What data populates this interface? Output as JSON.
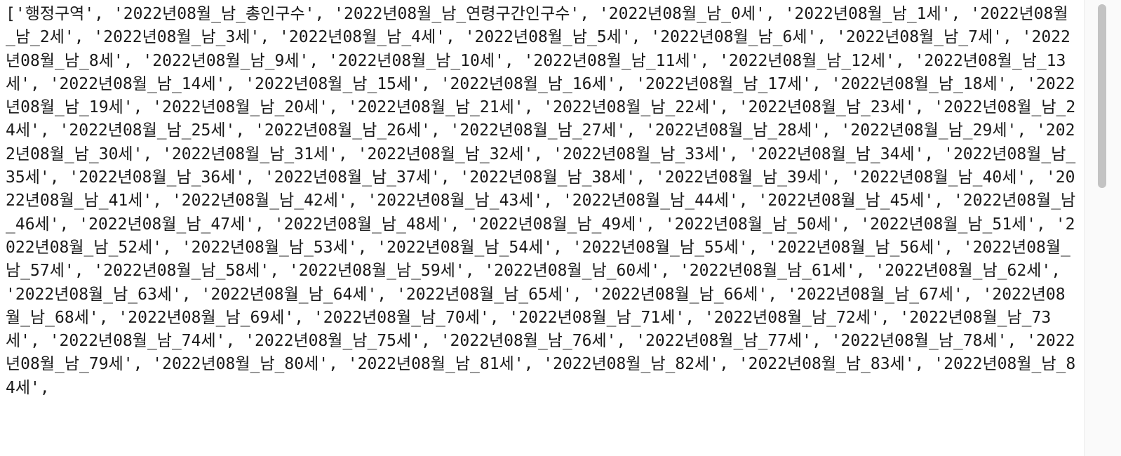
{
  "output": {
    "label": "output",
    "columns": [
      "행정구역",
      "2022년08월_남_총인구수",
      "2022년08월_남_연령구간인구수",
      "2022년08월_남_0세",
      "2022년08월_남_1세",
      "2022년08월_남_2세",
      "2022년08월_남_3세",
      "2022년08월_남_4세",
      "2022년08월_남_5세",
      "2022년08월_남_6세",
      "2022년08월_남_7세",
      "2022년08월_남_8세",
      "2022년08월_남_9세",
      "2022년08월_남_10세",
      "2022년08월_남_11세",
      "2022년08월_남_12세",
      "2022년08월_남_13세",
      "2022년08월_남_14세",
      "2022년08월_남_15세",
      "2022년08월_남_16세",
      "2022년08월_남_17세",
      "2022년08월_남_18세",
      "2022년08월_남_19세",
      "2022년08월_남_20세",
      "2022년08월_남_21세",
      "2022년08월_남_22세",
      "2022년08월_남_23세",
      "2022년08월_남_24세",
      "2022년08월_남_25세",
      "2022년08월_남_26세",
      "2022년08월_남_27세",
      "2022년08월_남_28세",
      "2022년08월_남_29세",
      "2022년08월_남_30세",
      "2022년08월_남_31세",
      "2022년08월_남_32세",
      "2022년08월_남_33세",
      "2022년08월_남_34세",
      "2022년08월_남_35세",
      "2022년08월_남_36세",
      "2022년08월_남_37세",
      "2022년08월_남_38세",
      "2022년08월_남_39세",
      "2022년08월_남_40세",
      "2022년08월_남_41세",
      "2022년08월_남_42세",
      "2022년08월_남_43세",
      "2022년08월_남_44세",
      "2022년08월_남_45세",
      "2022년08월_남_46세",
      "2022년08월_남_47세",
      "2022년08월_남_48세",
      "2022년08월_남_49세",
      "2022년08월_남_50세",
      "2022년08월_남_51세",
      "2022년08월_남_52세",
      "2022년08월_남_53세",
      "2022년08월_남_54세",
      "2022년08월_남_55세",
      "2022년08월_남_56세",
      "2022년08월_남_57세",
      "2022년08월_남_58세",
      "2022년08월_남_59세",
      "2022년08월_남_60세",
      "2022년08월_남_61세",
      "2022년08월_남_62세",
      "2022년08월_남_63세",
      "2022년08월_남_64세",
      "2022년08월_남_65세",
      "2022년08월_남_66세",
      "2022년08월_남_67세",
      "2022년08월_남_68세",
      "2022년08월_남_69세",
      "2022년08월_남_70세",
      "2022년08월_남_71세",
      "2022년08월_남_72세",
      "2022년08월_남_73세",
      "2022년08월_남_74세",
      "2022년08월_남_75세",
      "2022년08월_남_76세",
      "2022년08월_남_77세",
      "2022년08월_남_78세",
      "2022년08월_남_79세",
      "2022년08월_남_80세",
      "2022년08월_남_81세",
      "2022년08월_남_82세",
      "2022년08월_남_83세",
      "2022년08월_남_84세"
    ],
    "text": ""
  }
}
